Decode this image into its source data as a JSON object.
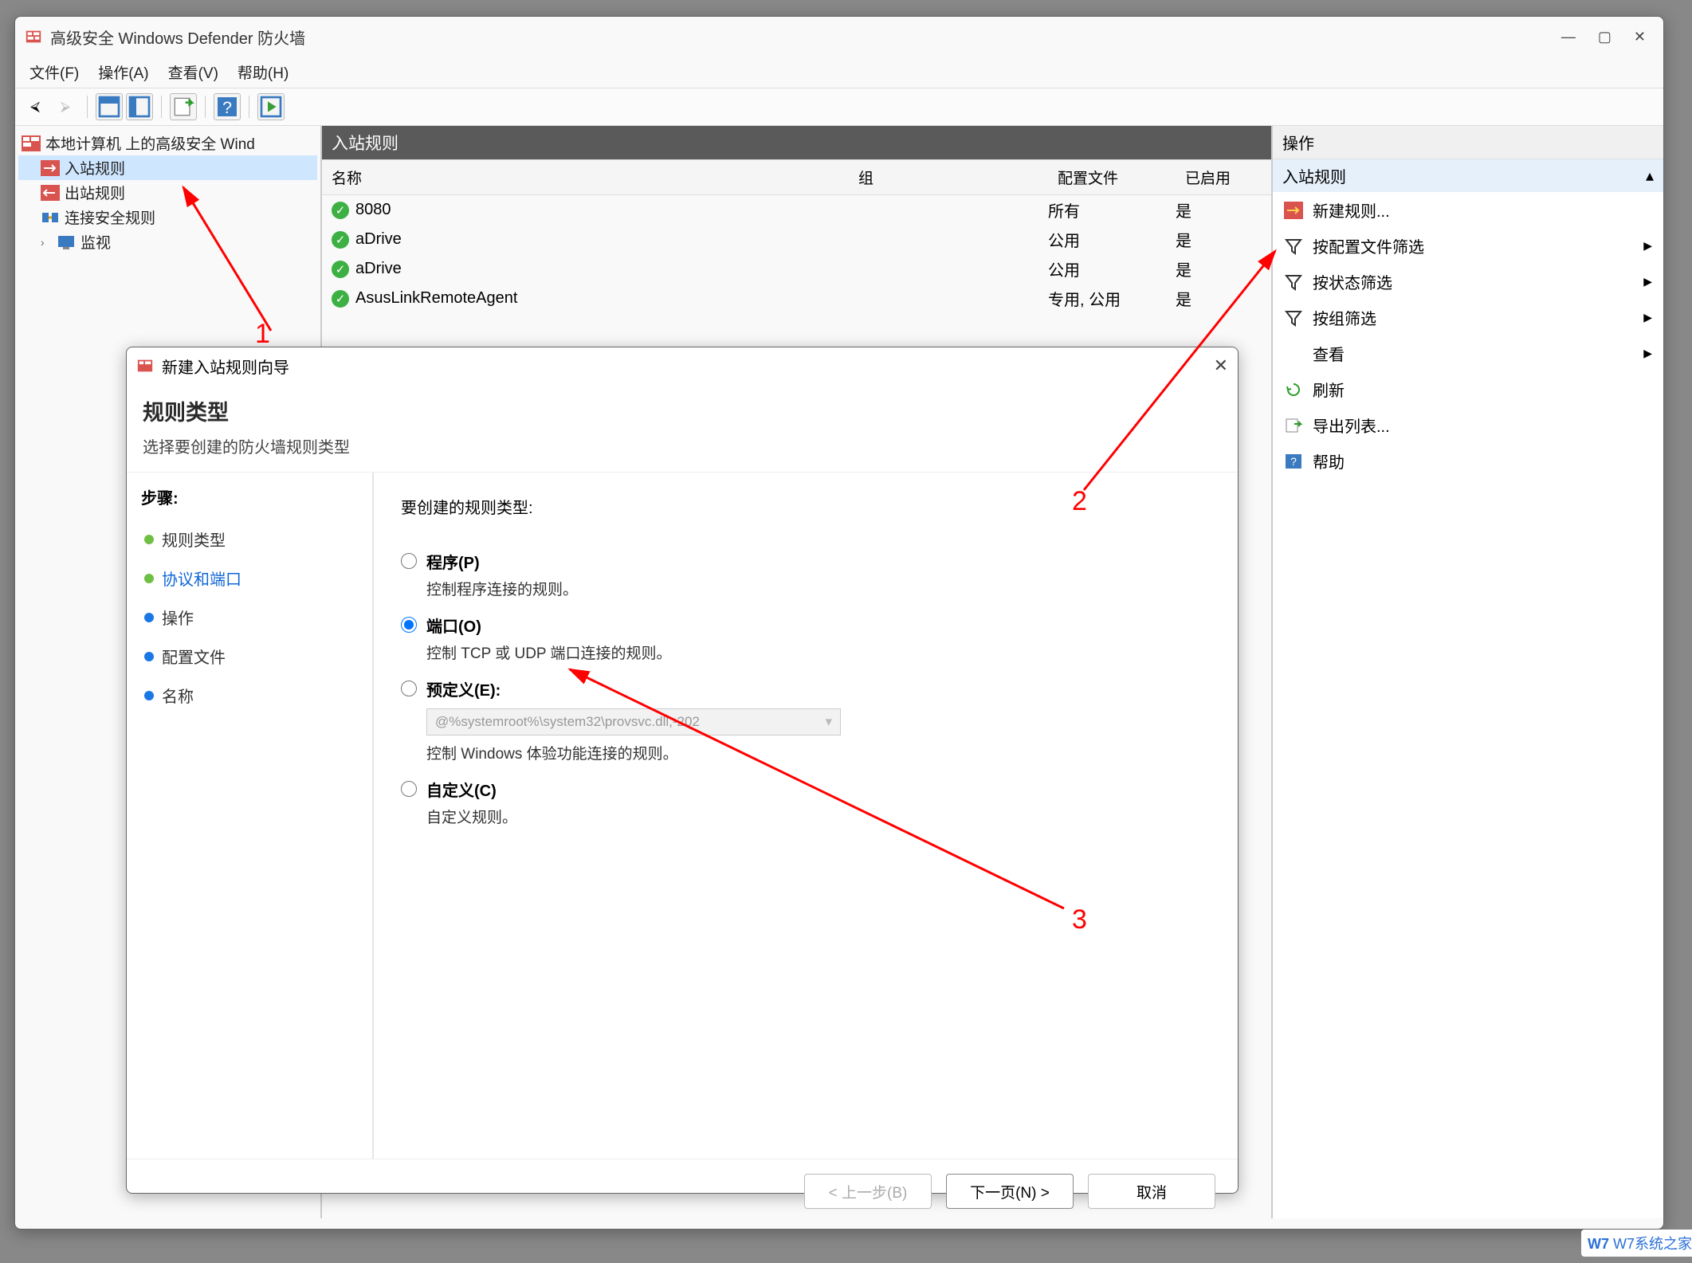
{
  "main_window": {
    "title": "高级安全 Windows Defender 防火墙",
    "menus": {
      "file": "文件(F)",
      "action": "操作(A)",
      "view": "查看(V)",
      "help": "帮助(H)"
    }
  },
  "tree": {
    "root": "本地计算机 上的高级安全 Wind",
    "items": [
      "入站规则",
      "出站规则",
      "连接安全规则",
      "监视"
    ]
  },
  "center": {
    "title": "入站规则",
    "columns": {
      "name": "名称",
      "group": "组",
      "profile": "配置文件",
      "enabled": "已启用"
    },
    "rows": [
      {
        "name": "8080",
        "group": "",
        "profile": "所有",
        "enabled": "是"
      },
      {
        "name": "aDrive",
        "group": "",
        "profile": "公用",
        "enabled": "是"
      },
      {
        "name": "aDrive",
        "group": "",
        "profile": "公用",
        "enabled": "是"
      },
      {
        "name": "AsusLinkRemoteAgent",
        "group": "",
        "profile": "专用, 公用",
        "enabled": "是"
      }
    ]
  },
  "actions": {
    "header": "操作",
    "section": "入站规则",
    "items": [
      {
        "label": "新建规则...",
        "icon": "new-rule",
        "chev": false
      },
      {
        "label": "按配置文件筛选",
        "icon": "filter",
        "chev": true
      },
      {
        "label": "按状态筛选",
        "icon": "filter",
        "chev": true
      },
      {
        "label": "按组筛选",
        "icon": "filter",
        "chev": true
      },
      {
        "label": "查看",
        "icon": "none",
        "chev": true
      },
      {
        "label": "刷新",
        "icon": "refresh",
        "chev": false
      },
      {
        "label": "导出列表...",
        "icon": "export",
        "chev": false
      },
      {
        "label": "帮助",
        "icon": "help",
        "chev": false
      }
    ]
  },
  "wizard": {
    "title": "新建入站规则向导",
    "heading": "规则类型",
    "subheading": "选择要创建的防火墙规则类型",
    "steps_label": "步骤:",
    "steps": [
      "规则类型",
      "协议和端口",
      "操作",
      "配置文件",
      "名称"
    ],
    "active_step_index": 1,
    "prompt": "要创建的规则类型:",
    "options": {
      "program": {
        "label": "程序(P)",
        "desc": "控制程序连接的规则。"
      },
      "port": {
        "label": "端口(O)",
        "desc": "控制 TCP 或 UDP 端口连接的规则。"
      },
      "predefined": {
        "label": "预定义(E):",
        "dropdown": "@%systemroot%\\system32\\provsvc.dll,-202",
        "desc": "控制 Windows 体验功能连接的规则。"
      },
      "custom": {
        "label": "自定义(C)",
        "desc": "自定义规则。"
      }
    },
    "selected": "port",
    "buttons": {
      "back": "< 上一步(B)",
      "next": "下一页(N) >",
      "cancel": "取消"
    }
  },
  "annotations": {
    "n1": "1",
    "n2": "2",
    "n3": "3"
  },
  "watermark": "W7系统之家"
}
